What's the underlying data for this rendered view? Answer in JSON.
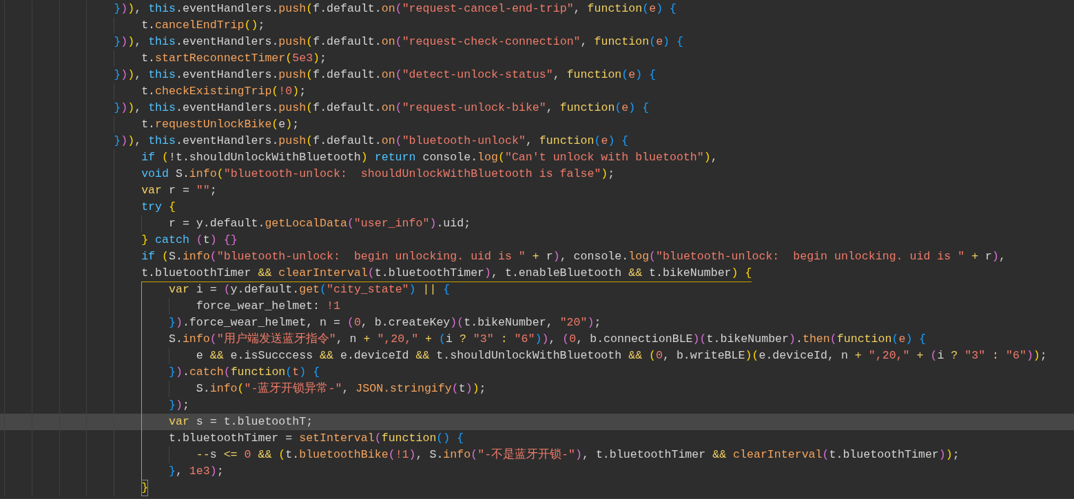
{
  "editor": {
    "lines": [
      {
        "tokens": [
          {
            "kind": "b3",
            "text": "}"
          },
          {
            "kind": "b2",
            "text": ")"
          },
          {
            "kind": "b1",
            "text": ")"
          },
          {
            "kind": "plain",
            "text": ", "
          },
          {
            "kind": "keyword",
            "text": "this"
          },
          {
            "kind": "plain",
            "text": ".eventHandlers."
          },
          {
            "kind": "method",
            "text": "push"
          },
          {
            "kind": "b1",
            "text": "("
          },
          {
            "kind": "plain",
            "text": "f.default."
          },
          {
            "kind": "method",
            "text": "on"
          },
          {
            "kind": "b2",
            "text": "("
          },
          {
            "kind": "string",
            "text": "\"request-cancel-end-trip\""
          },
          {
            "kind": "plain",
            "text": ", "
          },
          {
            "kind": "storage",
            "text": "function"
          },
          {
            "kind": "b3",
            "text": "("
          },
          {
            "kind": "param",
            "text": "e"
          },
          {
            "kind": "b3",
            "text": ") "
          },
          {
            "kind": "b3",
            "text": "{"
          }
        ],
        "children": [
          {
            "tokens": [
              {
                "kind": "plain",
                "text": "t."
              },
              {
                "kind": "method",
                "text": "cancelEndTrip"
              },
              {
                "kind": "b1",
                "text": "()"
              },
              {
                "kind": "plain",
                "text": ";"
              }
            ]
          }
        ]
      },
      {
        "tokens": [
          {
            "kind": "b3",
            "text": "}"
          },
          {
            "kind": "b2",
            "text": ")"
          },
          {
            "kind": "b1",
            "text": ")"
          },
          {
            "kind": "plain",
            "text": ", "
          },
          {
            "kind": "keyword",
            "text": "this"
          },
          {
            "kind": "plain",
            "text": ".eventHandlers."
          },
          {
            "kind": "method",
            "text": "push"
          },
          {
            "kind": "b1",
            "text": "("
          },
          {
            "kind": "plain",
            "text": "f.default."
          },
          {
            "kind": "method",
            "text": "on"
          },
          {
            "kind": "b2",
            "text": "("
          },
          {
            "kind": "string",
            "text": "\"request-check-connection\""
          },
          {
            "kind": "plain",
            "text": ", "
          },
          {
            "kind": "storage",
            "text": "function"
          },
          {
            "kind": "b3",
            "text": "("
          },
          {
            "kind": "param",
            "text": "e"
          },
          {
            "kind": "b3",
            "text": ") "
          },
          {
            "kind": "b3",
            "text": "{"
          }
        ],
        "children": [
          {
            "tokens": [
              {
                "kind": "plain",
                "text": "t."
              },
              {
                "kind": "method",
                "text": "startReconnectTimer"
              },
              {
                "kind": "b1",
                "text": "("
              },
              {
                "kind": "number",
                "text": "5e3"
              },
              {
                "kind": "b1",
                "text": ")"
              },
              {
                "kind": "plain",
                "text": ";"
              }
            ]
          }
        ]
      },
      {
        "tokens": [
          {
            "kind": "b3",
            "text": "}"
          },
          {
            "kind": "b2",
            "text": ")"
          },
          {
            "kind": "b1",
            "text": ")"
          },
          {
            "kind": "plain",
            "text": ", "
          },
          {
            "kind": "keyword",
            "text": "this"
          },
          {
            "kind": "plain",
            "text": ".eventHandlers."
          },
          {
            "kind": "method",
            "text": "push"
          },
          {
            "kind": "b1",
            "text": "("
          },
          {
            "kind": "plain",
            "text": "f.default."
          },
          {
            "kind": "method",
            "text": "on"
          },
          {
            "kind": "b2",
            "text": "("
          },
          {
            "kind": "string",
            "text": "\"detect-unlock-status\""
          },
          {
            "kind": "plain",
            "text": ", "
          },
          {
            "kind": "storage",
            "text": "function"
          },
          {
            "kind": "b3",
            "text": "("
          },
          {
            "kind": "param",
            "text": "e"
          },
          {
            "kind": "b3",
            "text": ") "
          },
          {
            "kind": "b3",
            "text": "{"
          }
        ],
        "children": [
          {
            "tokens": [
              {
                "kind": "plain",
                "text": "t."
              },
              {
                "kind": "method",
                "text": "checkExistingTrip"
              },
              {
                "kind": "b1",
                "text": "("
              },
              {
                "kind": "number",
                "text": "!0"
              },
              {
                "kind": "b1",
                "text": ")"
              },
              {
                "kind": "plain",
                "text": ";"
              }
            ]
          }
        ]
      },
      {
        "tokens": [
          {
            "kind": "b3",
            "text": "}"
          },
          {
            "kind": "b2",
            "text": ")"
          },
          {
            "kind": "b1",
            "text": ")"
          },
          {
            "kind": "plain",
            "text": ", "
          },
          {
            "kind": "keyword",
            "text": "this"
          },
          {
            "kind": "plain",
            "text": ".eventHandlers."
          },
          {
            "kind": "method",
            "text": "push"
          },
          {
            "kind": "b1",
            "text": "("
          },
          {
            "kind": "plain",
            "text": "f.default."
          },
          {
            "kind": "method",
            "text": "on"
          },
          {
            "kind": "b2",
            "text": "("
          },
          {
            "kind": "string",
            "text": "\"request-unlock-bike\""
          },
          {
            "kind": "plain",
            "text": ", "
          },
          {
            "kind": "storage",
            "text": "function"
          },
          {
            "kind": "b3",
            "text": "("
          },
          {
            "kind": "param",
            "text": "e"
          },
          {
            "kind": "b3",
            "text": ") "
          },
          {
            "kind": "b3",
            "text": "{"
          }
        ],
        "children": [
          {
            "tokens": [
              {
                "kind": "plain",
                "text": "t."
              },
              {
                "kind": "method",
                "text": "requestUnlockBike"
              },
              {
                "kind": "b1",
                "text": "("
              },
              {
                "kind": "plain",
                "text": "e"
              },
              {
                "kind": "b1",
                "text": ")"
              },
              {
                "kind": "plain",
                "text": ";"
              }
            ]
          }
        ]
      },
      {
        "tokens": [
          {
            "kind": "b3",
            "text": "}"
          },
          {
            "kind": "b2",
            "text": ")"
          },
          {
            "kind": "b1",
            "text": ")"
          },
          {
            "kind": "plain",
            "text": ", "
          },
          {
            "kind": "keyword",
            "text": "this"
          },
          {
            "kind": "plain",
            "text": ".eventHandlers."
          },
          {
            "kind": "method",
            "text": "push"
          },
          {
            "kind": "b1",
            "text": "("
          },
          {
            "kind": "plain",
            "text": "f.default."
          },
          {
            "kind": "method",
            "text": "on"
          },
          {
            "kind": "b2",
            "text": "("
          },
          {
            "kind": "string",
            "text": "\"bluetooth-unlock\""
          },
          {
            "kind": "plain",
            "text": ", "
          },
          {
            "kind": "storage",
            "text": "function"
          },
          {
            "kind": "b3",
            "text": "("
          },
          {
            "kind": "param",
            "text": "e"
          },
          {
            "kind": "b3",
            "text": ") "
          },
          {
            "kind": "b3",
            "text": "{"
          }
        ],
        "children": [
          {
            "bracket_match": false,
            "tokens": [
              {
                "kind": "keyword",
                "text": "if "
              },
              {
                "kind": "b1",
                "text": "("
              },
              {
                "kind": "plain",
                "text": "!t.shouldUnlockWithBluetooth"
              },
              {
                "kind": "b1",
                "text": ") "
              },
              {
                "kind": "keyword",
                "text": "return"
              },
              {
                "kind": "plain",
                "text": " console."
              },
              {
                "kind": "method",
                "text": "log"
              },
              {
                "kind": "b1",
                "text": "("
              },
              {
                "kind": "string",
                "text": "\"Can't unlock with bluetooth\""
              },
              {
                "kind": "b1",
                "text": ")"
              },
              {
                "kind": "plain",
                "text": ","
              }
            ]
          },
          {
            "bracket_match": false,
            "tokens": [
              {
                "kind": "keyword",
                "text": "void"
              },
              {
                "kind": "plain",
                "text": " S."
              },
              {
                "kind": "method",
                "text": "info"
              },
              {
                "kind": "b1",
                "text": "("
              },
              {
                "kind": "string",
                "text": "\"bluetooth-unlock:  shouldUnlockWithBluetooth is false\""
              },
              {
                "kind": "b1",
                "text": ")"
              },
              {
                "kind": "plain",
                "text": ";"
              }
            ]
          },
          {
            "bracket_match": false,
            "tokens": [
              {
                "kind": "storage",
                "text": "var"
              },
              {
                "kind": "plain",
                "text": " r = "
              },
              {
                "kind": "string",
                "text": "\"\""
              },
              {
                "kind": "plain",
                "text": ";"
              }
            ]
          },
          {
            "scope_highlight": false,
            "bracket_match": false,
            "tokens": [
              {
                "kind": "keyword",
                "text": "try "
              },
              {
                "kind": "b1",
                "text": "{"
              }
            ],
            "children": [
              {
                "tokens": [
                  {
                    "kind": "plain",
                    "text": "r = y.default."
                  },
                  {
                    "kind": "method",
                    "text": "getLocalData"
                  },
                  {
                    "kind": "b2",
                    "text": "("
                  },
                  {
                    "kind": "string",
                    "text": "\"user_info\""
                  },
                  {
                    "kind": "b2",
                    "text": ")"
                  },
                  {
                    "kind": "plain",
                    "text": ".uid;"
                  }
                ]
              }
            ]
          },
          {
            "bracket_match": false,
            "tokens": [
              {
                "kind": "b1",
                "text": "} "
              },
              {
                "kind": "keyword",
                "text": "catch "
              },
              {
                "kind": "b2",
                "text": "("
              },
              {
                "kind": "plain",
                "text": "t"
              },
              {
                "kind": "b2",
                "text": ") "
              },
              {
                "kind": "b2",
                "text": "{}"
              }
            ]
          },
          {
            "bracket_match": false,
            "tokens": [
              {
                "kind": "keyword",
                "text": "if "
              },
              {
                "kind": "b1",
                "text": "("
              },
              {
                "kind": "plain",
                "text": "S."
              },
              {
                "kind": "method",
                "text": "info"
              },
              {
                "kind": "b2",
                "text": "("
              },
              {
                "kind": "string",
                "text": "\"bluetooth-unlock:  begin unlocking. uid is \""
              },
              {
                "kind": "op",
                "text": " +"
              },
              {
                "kind": "plain",
                "text": " r"
              },
              {
                "kind": "b2",
                "text": ")"
              },
              {
                "kind": "plain",
                "text": ", console."
              },
              {
                "kind": "method",
                "text": "log"
              },
              {
                "kind": "b2",
                "text": "("
              },
              {
                "kind": "string",
                "text": "\"bluetooth-unlock:  begin unlocking. uid is \""
              },
              {
                "kind": "op",
                "text": " +"
              },
              {
                "kind": "plain",
                "text": " r"
              },
              {
                "kind": "b2",
                "text": ")"
              },
              {
                "kind": "plain",
                "text": ","
              }
            ]
          },
          {
            "scope_highlight": true,
            "bracket_match": false,
            "tokens": [
              {
                "kind": "plain",
                "text": "t.bluetoothTimer "
              },
              {
                "kind": "op",
                "text": "&& "
              },
              {
                "kind": "method",
                "text": "clearInterval"
              },
              {
                "kind": "b2",
                "text": "("
              },
              {
                "kind": "plain",
                "text": "t.bluetoothTimer"
              },
              {
                "kind": "b2",
                "text": ")"
              },
              {
                "kind": "plain",
                "text": ", t.enableBluetooth "
              },
              {
                "kind": "op",
                "text": "&&"
              },
              {
                "kind": "plain",
                "text": " t.bikeNumber"
              },
              {
                "kind": "b1",
                "text": ") "
              },
              {
                "kind": "b1",
                "text": "{"
              }
            ],
            "children": [
              {
                "current_line": false,
                "tokens": [
                  {
                    "kind": "storage",
                    "text": "var"
                  },
                  {
                    "kind": "plain",
                    "text": " i = "
                  },
                  {
                    "kind": "b2",
                    "text": "("
                  },
                  {
                    "kind": "plain",
                    "text": "y.default."
                  },
                  {
                    "kind": "method",
                    "text": "get"
                  },
                  {
                    "kind": "b3",
                    "text": "("
                  },
                  {
                    "kind": "string",
                    "text": "\"city_state\""
                  },
                  {
                    "kind": "b3",
                    "text": ") "
                  },
                  {
                    "kind": "op",
                    "text": "|| "
                  },
                  {
                    "kind": "b3",
                    "text": "{"
                  }
                ],
                "children": [
                  {
                    "tokens": [
                      {
                        "kind": "plain",
                        "text": "force_wear_helmet: "
                      },
                      {
                        "kind": "number",
                        "text": "!1"
                      }
                    ]
                  }
                ]
              },
              {
                "current_line": false,
                "tokens": [
                  {
                    "kind": "b3",
                    "text": "}"
                  },
                  {
                    "kind": "b2",
                    "text": ")"
                  },
                  {
                    "kind": "plain",
                    "text": ".force_wear_helmet, n = "
                  },
                  {
                    "kind": "b2",
                    "text": "("
                  },
                  {
                    "kind": "number",
                    "text": "0"
                  },
                  {
                    "kind": "plain",
                    "text": ", b.createKey"
                  },
                  {
                    "kind": "b2",
                    "text": ")"
                  },
                  {
                    "kind": "b2",
                    "text": "("
                  },
                  {
                    "kind": "plain",
                    "text": "t.bikeNumber, "
                  },
                  {
                    "kind": "string",
                    "text": "\"20\""
                  },
                  {
                    "kind": "b2",
                    "text": ")"
                  },
                  {
                    "kind": "plain",
                    "text": ";"
                  }
                ]
              },
              {
                "current_line": false,
                "tokens": [
                  {
                    "kind": "plain",
                    "text": "S."
                  },
                  {
                    "kind": "method",
                    "text": "info"
                  },
                  {
                    "kind": "b2",
                    "text": "("
                  },
                  {
                    "kind": "string",
                    "text": "\"用户端发送蓝牙指令\""
                  },
                  {
                    "kind": "plain",
                    "text": ", n "
                  },
                  {
                    "kind": "op",
                    "text": "+ "
                  },
                  {
                    "kind": "string",
                    "text": "\",20,\" "
                  },
                  {
                    "kind": "op",
                    "text": "+ "
                  },
                  {
                    "kind": "b3",
                    "text": "("
                  },
                  {
                    "kind": "plain",
                    "text": "i "
                  },
                  {
                    "kind": "op",
                    "text": "? "
                  },
                  {
                    "kind": "string",
                    "text": "\"3\" "
                  },
                  {
                    "kind": "op",
                    "text": ": "
                  },
                  {
                    "kind": "string",
                    "text": "\"6\""
                  },
                  {
                    "kind": "b3",
                    "text": ")"
                  },
                  {
                    "kind": "b2",
                    "text": ")"
                  },
                  {
                    "kind": "plain",
                    "text": ", "
                  },
                  {
                    "kind": "b2",
                    "text": "("
                  },
                  {
                    "kind": "number",
                    "text": "0"
                  },
                  {
                    "kind": "plain",
                    "text": ", b.connectionBLE"
                  },
                  {
                    "kind": "b2",
                    "text": ")"
                  },
                  {
                    "kind": "b2",
                    "text": "("
                  },
                  {
                    "kind": "plain",
                    "text": "t.bikeNumber"
                  },
                  {
                    "kind": "b2",
                    "text": ")"
                  },
                  {
                    "kind": "plain",
                    "text": "."
                  },
                  {
                    "kind": "method",
                    "text": "then"
                  },
                  {
                    "kind": "b2",
                    "text": "("
                  },
                  {
                    "kind": "storage",
                    "text": "function"
                  },
                  {
                    "kind": "b3",
                    "text": "("
                  },
                  {
                    "kind": "param",
                    "text": "e"
                  },
                  {
                    "kind": "b3",
                    "text": ") "
                  },
                  {
                    "kind": "b3",
                    "text": "{"
                  }
                ],
                "children": [
                  {
                    "tokens": [
                      {
                        "kind": "plain",
                        "text": "e "
                      },
                      {
                        "kind": "op",
                        "text": "&&"
                      },
                      {
                        "kind": "plain",
                        "text": " e.isSucccess "
                      },
                      {
                        "kind": "op",
                        "text": "&&"
                      },
                      {
                        "kind": "plain",
                        "text": " e.deviceId "
                      },
                      {
                        "kind": "op",
                        "text": "&&"
                      },
                      {
                        "kind": "plain",
                        "text": " t.shouldUnlockWithBluetooth "
                      },
                      {
                        "kind": "op",
                        "text": "&& "
                      },
                      {
                        "kind": "b1",
                        "text": "("
                      },
                      {
                        "kind": "number",
                        "text": "0"
                      },
                      {
                        "kind": "plain",
                        "text": ", b.writeBLE"
                      },
                      {
                        "kind": "b1",
                        "text": ")"
                      },
                      {
                        "kind": "b1",
                        "text": "("
                      },
                      {
                        "kind": "plain",
                        "text": "e.deviceId, n "
                      },
                      {
                        "kind": "op",
                        "text": "+ "
                      },
                      {
                        "kind": "string",
                        "text": "\",20,\" "
                      },
                      {
                        "kind": "op",
                        "text": "+ "
                      },
                      {
                        "kind": "b2",
                        "text": "("
                      },
                      {
                        "kind": "plain",
                        "text": "i "
                      },
                      {
                        "kind": "op",
                        "text": "? "
                      },
                      {
                        "kind": "string",
                        "text": "\"3\" "
                      },
                      {
                        "kind": "op",
                        "text": ": "
                      },
                      {
                        "kind": "string",
                        "text": "\"6\""
                      },
                      {
                        "kind": "b2",
                        "text": ")"
                      },
                      {
                        "kind": "b1",
                        "text": ")"
                      },
                      {
                        "kind": "plain",
                        "text": ";"
                      }
                    ]
                  }
                ]
              },
              {
                "current_line": false,
                "tokens": [
                  {
                    "kind": "b3",
                    "text": "}"
                  },
                  {
                    "kind": "b2",
                    "text": ")"
                  },
                  {
                    "kind": "plain",
                    "text": "."
                  },
                  {
                    "kind": "method",
                    "text": "catch"
                  },
                  {
                    "kind": "b2",
                    "text": "("
                  },
                  {
                    "kind": "storage",
                    "text": "function"
                  },
                  {
                    "kind": "b3",
                    "text": "("
                  },
                  {
                    "kind": "param",
                    "text": "t"
                  },
                  {
                    "kind": "b3",
                    "text": ") "
                  },
                  {
                    "kind": "b3",
                    "text": "{"
                  }
                ],
                "children": [
                  {
                    "tokens": [
                      {
                        "kind": "plain",
                        "text": "S."
                      },
                      {
                        "kind": "method",
                        "text": "info"
                      },
                      {
                        "kind": "b1",
                        "text": "("
                      },
                      {
                        "kind": "string",
                        "text": "\"-蓝牙开锁异常-\""
                      },
                      {
                        "kind": "plain",
                        "text": ", "
                      },
                      {
                        "kind": "method",
                        "text": "JSON.stringify"
                      },
                      {
                        "kind": "b2",
                        "text": "("
                      },
                      {
                        "kind": "plain",
                        "text": "t"
                      },
                      {
                        "kind": "b2",
                        "text": ")"
                      },
                      {
                        "kind": "b1",
                        "text": ")"
                      },
                      {
                        "kind": "plain",
                        "text": ";"
                      }
                    ]
                  }
                ]
              },
              {
                "current_line": false,
                "tokens": [
                  {
                    "kind": "b3",
                    "text": "}"
                  },
                  {
                    "kind": "b2",
                    "text": ")"
                  },
                  {
                    "kind": "plain",
                    "text": ";"
                  }
                ]
              },
              {
                "current_line": true,
                "tokens": [
                  {
                    "kind": "storage",
                    "text": "var"
                  },
                  {
                    "kind": "plain",
                    "text": " s = t.bluetoothT;"
                  }
                ]
              },
              {
                "current_line": false,
                "tokens": [
                  {
                    "kind": "plain",
                    "text": "t.bluetoothTimer = "
                  },
                  {
                    "kind": "method",
                    "text": "setInterval"
                  },
                  {
                    "kind": "b2",
                    "text": "("
                  },
                  {
                    "kind": "storage",
                    "text": "function"
                  },
                  {
                    "kind": "b3",
                    "text": "() "
                  },
                  {
                    "kind": "b3",
                    "text": "{"
                  }
                ],
                "children": [
                  {
                    "tokens": [
                      {
                        "kind": "op",
                        "text": "--"
                      },
                      {
                        "kind": "plain",
                        "text": "s "
                      },
                      {
                        "kind": "op",
                        "text": "<= "
                      },
                      {
                        "kind": "number",
                        "text": "0 "
                      },
                      {
                        "kind": "op",
                        "text": "&& "
                      },
                      {
                        "kind": "b1",
                        "text": "("
                      },
                      {
                        "kind": "plain",
                        "text": "t."
                      },
                      {
                        "kind": "method",
                        "text": "bluetoothBike"
                      },
                      {
                        "kind": "b2",
                        "text": "("
                      },
                      {
                        "kind": "number",
                        "text": "!1"
                      },
                      {
                        "kind": "b2",
                        "text": ")"
                      },
                      {
                        "kind": "plain",
                        "text": ", S."
                      },
                      {
                        "kind": "method",
                        "text": "info"
                      },
                      {
                        "kind": "b2",
                        "text": "("
                      },
                      {
                        "kind": "string",
                        "text": "\"-不是蓝牙开锁-\""
                      },
                      {
                        "kind": "b2",
                        "text": ")"
                      },
                      {
                        "kind": "plain",
                        "text": ", t.bluetoothTimer "
                      },
                      {
                        "kind": "op",
                        "text": "&& "
                      },
                      {
                        "kind": "method",
                        "text": "clearInterval"
                      },
                      {
                        "kind": "b2",
                        "text": "("
                      },
                      {
                        "kind": "plain",
                        "text": "t.bluetoothTimer"
                      },
                      {
                        "kind": "b2",
                        "text": ")"
                      },
                      {
                        "kind": "b1",
                        "text": ")"
                      },
                      {
                        "kind": "plain",
                        "text": ";"
                      }
                    ]
                  }
                ]
              },
              {
                "current_line": false,
                "tokens": [
                  {
                    "kind": "b3",
                    "text": "}"
                  },
                  {
                    "kind": "plain",
                    "text": ", "
                  },
                  {
                    "kind": "number",
                    "text": "1e3"
                  },
                  {
                    "kind": "b2",
                    "text": ")"
                  },
                  {
                    "kind": "plain",
                    "text": ";"
                  }
                ]
              }
            ]
          },
          {
            "bracket_match": true,
            "tokens": [
              {
                "kind": "b1",
                "text": "}"
              }
            ]
          }
        ]
      }
    ]
  }
}
